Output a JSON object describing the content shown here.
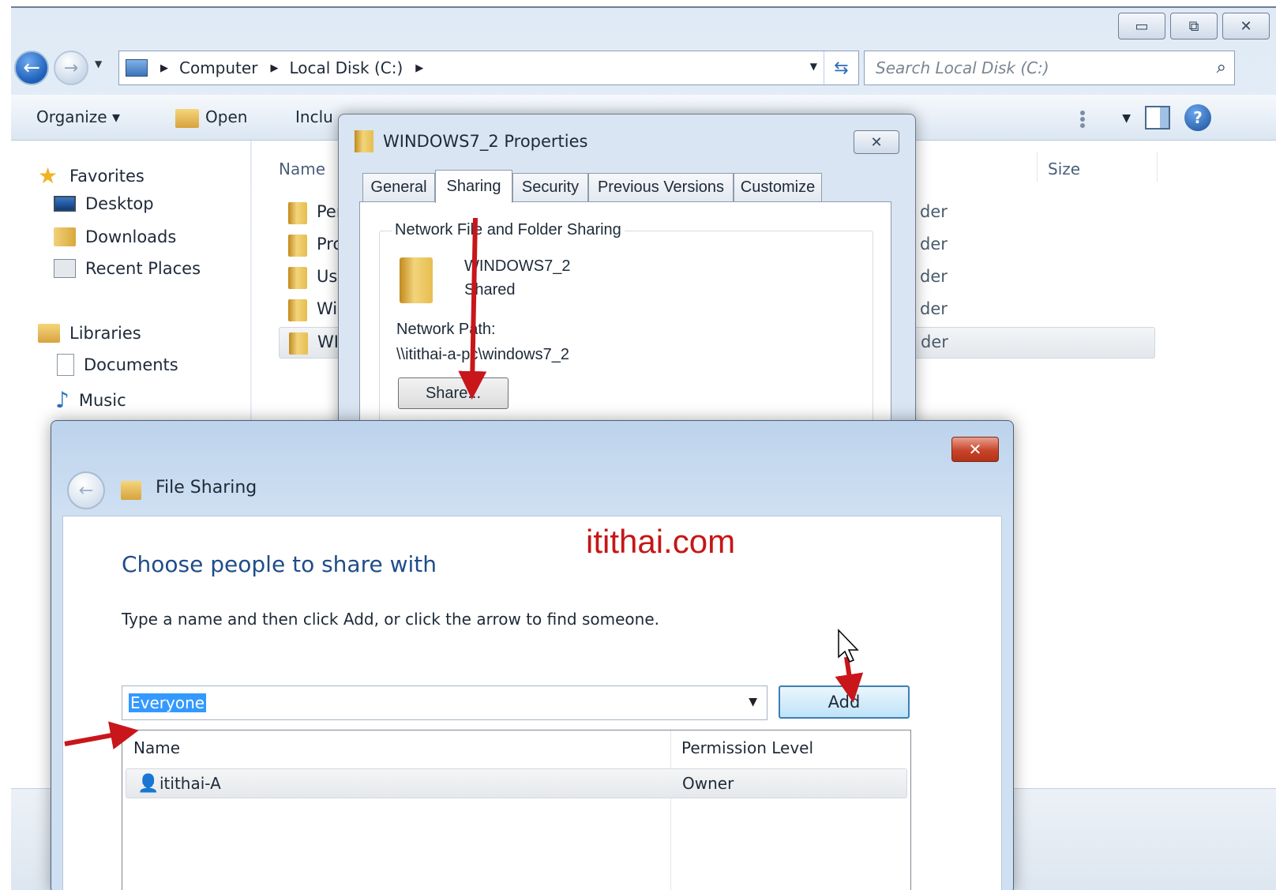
{
  "explorer": {
    "breadcrumb": [
      "Computer",
      "Local Disk (C:)"
    ],
    "search_placeholder": "Search Local Disk (C:)",
    "toolbar": {
      "organize": "Organize ▾",
      "open": "Open",
      "include": "Inclu"
    },
    "nav": {
      "favorites": "Favorites",
      "desktop": "Desktop",
      "downloads": "Downloads",
      "recent": "Recent Places",
      "libraries": "Libraries",
      "documents": "Documents",
      "music": "Music"
    },
    "columns": {
      "name": "Name",
      "size": "Size"
    },
    "files": [
      {
        "name": "Per",
        "type": "der"
      },
      {
        "name": "Pro",
        "type": "der"
      },
      {
        "name": "Use",
        "type": "der"
      },
      {
        "name": "Wi",
        "type": "der"
      },
      {
        "name": "WI",
        "type": "der"
      }
    ]
  },
  "properties": {
    "title": "WINDOWS7_2 Properties",
    "tabs": [
      "General",
      "Sharing",
      "Security",
      "Previous Versions",
      "Customize"
    ],
    "active_tab": "Sharing",
    "group_label": "Network File and Folder Sharing",
    "folder_name": "WINDOWS7_2",
    "folder_status": "Shared",
    "network_path_label": "Network Path:",
    "network_path": "\\\\itithai-a-pc\\windows7_2",
    "share_button": "Share..."
  },
  "wizard": {
    "title": "File Sharing",
    "watermark": "itithai.com",
    "heading": "Choose people to share with",
    "instruction": "Type a name and then click Add, or click the arrow to find someone.",
    "name_value": "Everyone",
    "add_button": "Add",
    "table_headers": {
      "name": "Name",
      "permission": "Permission Level"
    },
    "rows": [
      {
        "name": "itithai-A",
        "permission": "Owner"
      }
    ]
  },
  "colors": {
    "arrow": "#c8161b",
    "accent_blue": "#1f4d8a",
    "selection": "#3399ff",
    "close_red": "#c7452a"
  },
  "icons": [
    "back-arrow-icon",
    "forward-arrow-icon",
    "computer-icon",
    "refresh-icon",
    "search-icon",
    "folder-icon",
    "star-icon",
    "help-icon",
    "user-icon",
    "mouse-cursor-icon"
  ]
}
